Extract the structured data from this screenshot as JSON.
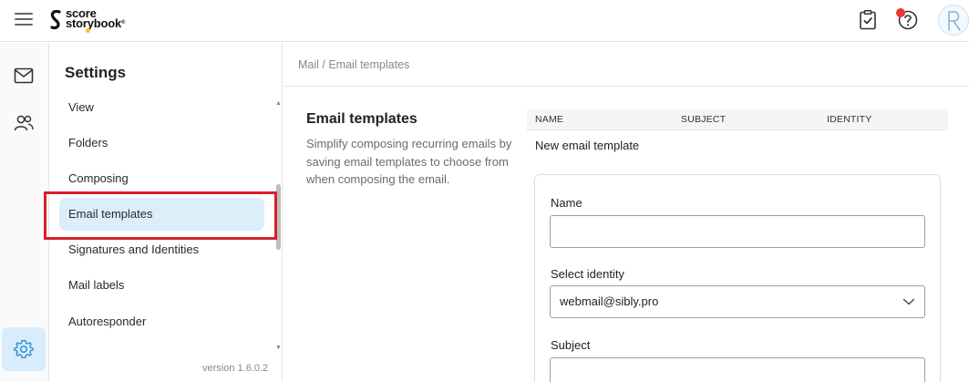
{
  "header": {
    "menu_icon": "hamburger-icon",
    "logo_line1": "score",
    "logo_line2": "storybook",
    "logo_reg": "®",
    "tasks_icon": "clipboard-check-icon",
    "help_icon": "help-circle-icon",
    "avatar_letter": "R"
  },
  "rail": {
    "items": [
      {
        "icon": "mail-icon"
      },
      {
        "icon": "contacts-icon"
      },
      {
        "icon": "gear-icon",
        "active": true
      }
    ]
  },
  "settings": {
    "title": "Settings",
    "items": [
      {
        "label": "View"
      },
      {
        "label": "Folders"
      },
      {
        "label": "Composing"
      },
      {
        "label": "Email templates",
        "active": true
      },
      {
        "label": "Signatures and Identities"
      },
      {
        "label": "Mail labels"
      },
      {
        "label": "Autoresponder"
      }
    ],
    "version": "version 1.6.0.2"
  },
  "breadcrumb": "Mail / Email templates",
  "section": {
    "title": "Email templates",
    "description": "Simplify composing recurring emails by saving email templates to choose from when composing the email."
  },
  "table": {
    "columns": [
      "NAME",
      "SUBJECT",
      "IDENTITY"
    ],
    "new_row_label": "New email template"
  },
  "form": {
    "name_label": "Name",
    "name_value": "",
    "identity_label": "Select identity",
    "identity_value": "webmail@sibly.pro",
    "subject_label": "Subject",
    "subject_value": ""
  },
  "colors": {
    "accent": "#2f8fd6",
    "active_bg": "#ddeefb",
    "highlight": "#d62027",
    "notification": "#e53935"
  }
}
